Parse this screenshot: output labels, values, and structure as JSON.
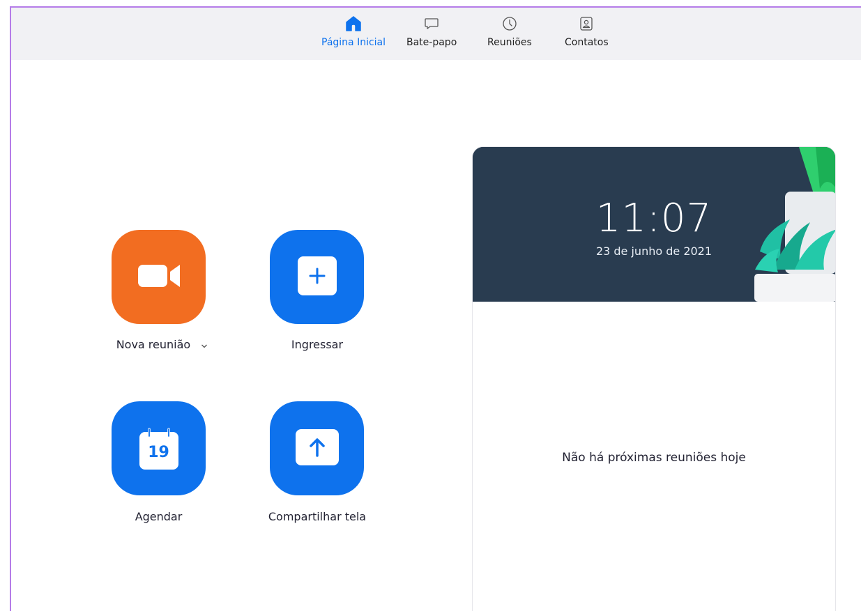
{
  "nav": {
    "tabs": [
      {
        "label": "Página Inicial",
        "icon": "home-icon",
        "active": true
      },
      {
        "label": "Bate-papo",
        "icon": "chat-icon",
        "active": false
      },
      {
        "label": "Reuniões",
        "icon": "clock-icon",
        "active": false
      },
      {
        "label": "Contatos",
        "icon": "contact-icon",
        "active": false
      }
    ]
  },
  "actions": {
    "new_meeting": {
      "label": "Nova reunião",
      "icon": "video-camera-icon",
      "color": "#f26d21"
    },
    "join": {
      "label": "Ingressar",
      "icon": "plus-icon",
      "color": "#0e72ed"
    },
    "schedule": {
      "label": "Agendar",
      "icon": "calendar-icon",
      "calendar_day": "19",
      "color": "#0e72ed"
    },
    "share_screen": {
      "label": "Compartilhar tela",
      "icon": "upload-arrow-icon",
      "color": "#0e72ed"
    }
  },
  "calendar_card": {
    "time": "11:07",
    "date": "23 de junho de 2021",
    "empty_message": "Não há próximas reuniões hoje"
  },
  "colors": {
    "accent": "#0e72ed",
    "orange": "#f26d21",
    "hero_bg": "#2b3e55",
    "frame_border": "#b57ce8"
  }
}
